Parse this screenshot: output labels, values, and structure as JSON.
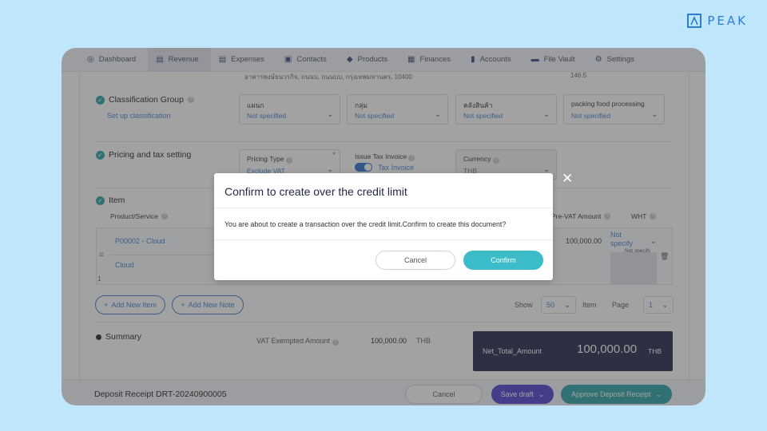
{
  "brand": {
    "name": "PEAK"
  },
  "nav": [
    {
      "label": "Dashboard",
      "icon": "dashboard-icon",
      "glyph": "◎"
    },
    {
      "label": "Revenue",
      "icon": "revenue-icon",
      "glyph": "▤"
    },
    {
      "label": "Expenses",
      "icon": "expenses-icon",
      "glyph": "▤"
    },
    {
      "label": "Contacts",
      "icon": "contacts-icon",
      "glyph": "▣"
    },
    {
      "label": "Products",
      "icon": "products-icon",
      "glyph": "◆"
    },
    {
      "label": "Finances",
      "icon": "finances-icon",
      "glyph": "▦"
    },
    {
      "label": "Accounts",
      "icon": "accounts-icon",
      "glyph": "▮"
    },
    {
      "label": "File Vault",
      "icon": "folder-icon",
      "glyph": "▬"
    },
    {
      "label": "Settings",
      "icon": "gear-icon",
      "glyph": "⚙"
    }
  ],
  "address": {
    "line": "อาคารพงษ์ธนวรกิจ, ถนนบ, ถนนบบ, กรุงเทพมหานคร, 10400",
    "right": "146.5"
  },
  "classification": {
    "title": "Classification Group",
    "setup_link": "Set up classification",
    "fields": [
      {
        "label": "แผนก",
        "value": "Not specified"
      },
      {
        "label": "กลุ่ม",
        "value": "Not specified"
      },
      {
        "label": "คลังสินค้า",
        "value": "Not specified"
      },
      {
        "label": "packing food processing",
        "value": "Not specified"
      }
    ]
  },
  "pricing": {
    "title": "Pricing and tax setting",
    "pricing_type_label": "Pricing Type",
    "pricing_type_value": "Exclude VAT",
    "issue_tax_label": "Issue Tax Invoice",
    "issue_tax_toggle_label": "Tax Invoice",
    "currency_label": "Currency",
    "currency_value": "THB"
  },
  "item": {
    "title": "Item",
    "col_product": "Product/Service",
    "col_pre_vat": "Pre-VAT Amount",
    "col_wht": "WHT",
    "row_code": "P00002 - Cloud",
    "row_desc": "Cloud",
    "row_num": "1",
    "row_amount": "100,000.00",
    "row_wht": "Not specify",
    "row_wht2": "Not specify"
  },
  "actions": {
    "add_item": "Add New Item",
    "add_note": "Add New Note",
    "show_label": "Show",
    "show_value": "50",
    "item_label": "Item",
    "page_label": "Page",
    "page_value": "1"
  },
  "summary": {
    "title": "Summary",
    "vat_exempt_label": "VAT Exempted Amount",
    "vat_exempt_value": "100,000.00",
    "vat_exempt_currency": "THB",
    "net_total_label": "Net_Total_Amount",
    "net_total_value": "100,000.00",
    "net_total_currency": "THB"
  },
  "footer": {
    "doc_label": "Deposit Receipt DRT-20240900005",
    "cancel": "Cancel",
    "save_draft": "Save draft",
    "approve": "Approve Deposit Receipt"
  },
  "modal": {
    "title": "Confirm to create over the credit limit",
    "message": "You are about to create a transaction over the credit limit.Confirm to create this document?",
    "cancel": "Cancel",
    "confirm": "Confirm"
  },
  "colors": {
    "accent": "#3c7fd0",
    "teal": "#3bbcc8",
    "dark_navy": "#1f2548",
    "purple": "#4b3fd1",
    "green": "#2aa2a6",
    "background": "#bfe6fb"
  }
}
